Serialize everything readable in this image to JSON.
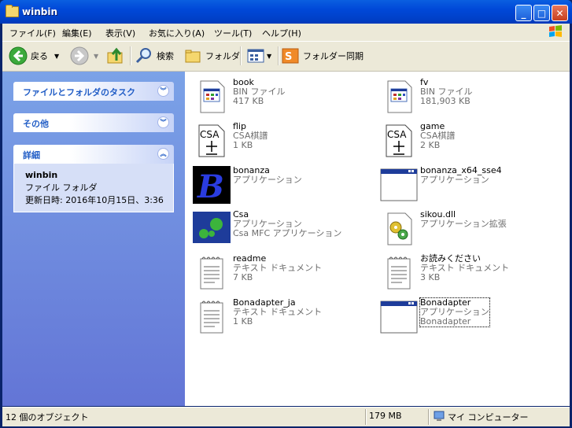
{
  "window": {
    "title": "winbin"
  },
  "menu": [
    "ファイル(F)",
    "編集(E)",
    "表示(V)",
    "お気に入り(A)",
    "ツール(T)",
    "ヘルプ(H)"
  ],
  "toolbar": {
    "back": "戻る",
    "search": "検索",
    "folders": "フォルダ",
    "sync": "フォルダー同期"
  },
  "tasks": {
    "file_tasks": "ファイルとフォルダのタスク",
    "other": "その他",
    "details": {
      "title": "詳細",
      "name": "winbin",
      "type": "ファイル フォルダ",
      "modified": "更新日時: 2016年10月15日、3:36"
    }
  },
  "files": [
    {
      "name": "book",
      "type": "BIN ファイル",
      "info": "417 KB",
      "icon": "bin-file-icon"
    },
    {
      "name": "fv",
      "type": "BIN ファイル",
      "info": "181,903 KB",
      "icon": "bin-file-icon"
    },
    {
      "name": "flip",
      "type": "CSA棋譜",
      "info": "1 KB",
      "icon": "csa-file-icon"
    },
    {
      "name": "game",
      "type": "CSA棋譜",
      "info": "2 KB",
      "icon": "csa-file-icon"
    },
    {
      "name": "bonanza",
      "type": "アプリケーション",
      "info": "",
      "icon": "bonanza-app-icon"
    },
    {
      "name": "bonanza_x64_sse4",
      "type": "アプリケーション",
      "info": "",
      "icon": "window-app-icon"
    },
    {
      "name": "Csa",
      "type": "アプリケーション",
      "info": "Csa MFC アプリケーション",
      "icon": "csa-app-icon"
    },
    {
      "name": "sikou.dll",
      "type": "アプリケーション拡張",
      "info": "",
      "icon": "dll-file-icon"
    },
    {
      "name": "readme",
      "type": "テキスト ドキュメント",
      "info": "7 KB",
      "icon": "notepad-icon"
    },
    {
      "name": "お読みください",
      "type": "テキスト ドキュメント",
      "info": "3 KB",
      "icon": "notepad-icon"
    },
    {
      "name": "Bonadapter_ja",
      "type": "テキスト ドキュメント",
      "info": "1 KB",
      "icon": "notepad-icon"
    },
    {
      "name": "Bonadapter",
      "type": "アプリケーション",
      "info": "Bonadapter",
      "icon": "window-app-icon"
    }
  ],
  "status": {
    "count": "12 個のオブジェクト",
    "size": "179 MB",
    "location": "マイ コンピューター"
  }
}
